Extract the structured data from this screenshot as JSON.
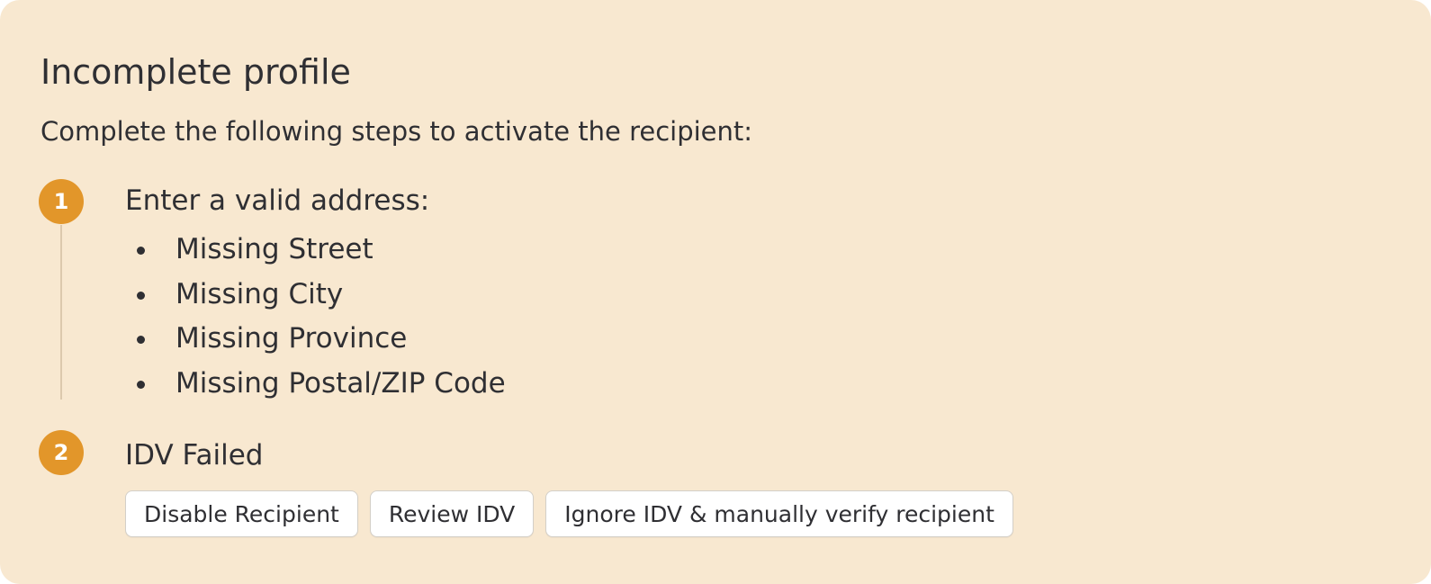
{
  "panel": {
    "title": "Incomplete profile",
    "subtitle": "Complete the following steps to activate the recipient:"
  },
  "colors": {
    "panel_background": "#f8e8d0",
    "step_badge": "#e2962a"
  },
  "steps": [
    {
      "number": "1",
      "title": "Enter a valid address:",
      "items": [
        "Missing Street",
        "Missing City",
        "Missing Province",
        "Missing Postal/ZIP Code"
      ]
    },
    {
      "number": "2",
      "title": "IDV Failed",
      "actions": [
        "Disable Recipient",
        "Review IDV",
        "Ignore IDV & manually verify recipient"
      ]
    }
  ]
}
